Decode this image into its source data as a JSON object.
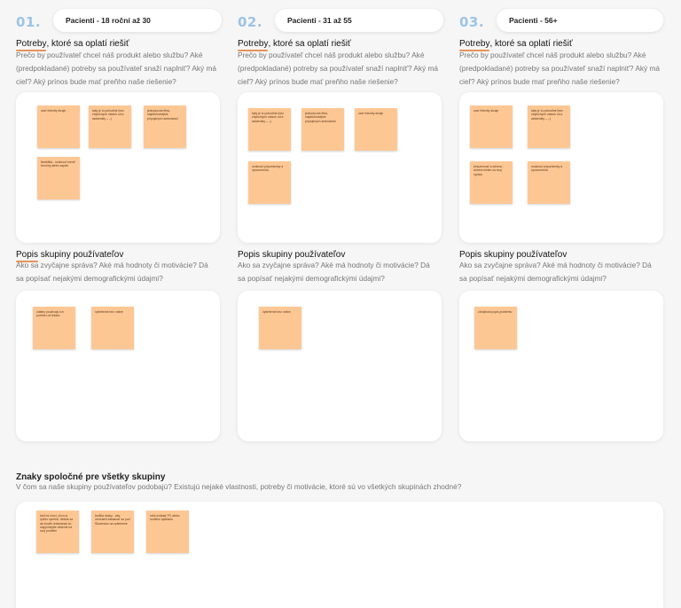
{
  "columns": [
    {
      "number": "01.",
      "group": "Pacienti - 18 roční až 30",
      "needs_notes": [
        "user friendly dizajn",
        "taký je to pohodlné (bez zbytočných otázok od a asistentky – –)",
        "jednoduchá filtra, najdôkľudnejšie prípojených ambulancií",
        "flexibilita - možnosť meniť termíny alebo zaplať"
      ],
      "users_notes": [
        "zdatný používajú ich potrebu od lekára",
        "vyšetrenie bez online"
      ]
    },
    {
      "number": "02.",
      "group": "Pacienti - 31 až 55",
      "needs_notes": [
        "taký je to pohodlné (bez zbytočných otázok od a asistentky – –)",
        "jednoduchá filtra, najdôkľudnejšie prípojených ambulancií",
        "user friendly dizajn",
        "možnosť pripomienky a upozornenia"
      ],
      "users_notes": [
        "vyšetrenie bez online"
      ]
    },
    {
      "number": "03.",
      "group": "Pacienti - 56+",
      "needs_notes": [
        "user friendly dizajn",
        "taký je to pohodlné (bez zbytočných otázok od a asistentky – –)",
        "bezpečnosť a dôvera - dôvera nielen za svoj sprácu",
        "možnosť pripomienky a upozornenia"
      ],
      "users_notes": [
        "zdrojitosti popis problému"
      ]
    }
  ],
  "sections": {
    "needs": {
      "title_underlined": "Potreby",
      "title_rest": ", ktoré sa oplatí riešiť",
      "description": "Prečo by používateľ chcel náš produkt alebo službu? Aké (predpokladané) potreby sa používateľ snaží naplniť? Aký má cieľ? Aký prínos bude mať preňho naše riešenie?"
    },
    "users": {
      "title_underlined": "Popis",
      "title_rest": " skupiny používateľov",
      "description": "Ako sa zvyčajne správa? Aké má hodnoty či motivácie? Dá sa popísať nejakými demografickými údajmi?"
    }
  },
  "common": {
    "title": "Znaky spoločné pre všetky skupiny",
    "description": "V čom sa naše skupiny používateľov podobajú? Existujú nejaké vlastnosti, potreby či motivácie, ktoré sú vo všetkých skupinách zhodné?",
    "notes": [
      "keď mi chorí, chcú si rýchlo vyriešiť, riešiak sa ak člověk lehtorabaš čo najrýchlejšie riešenie na svoj problém",
      "keďlíla dosky - aby nemuseli zakaznať sa pod Slovensko na vyšetrenie",
      "veľa ovládať PC alebo mobilnú aplikáciu"
    ]
  }
}
